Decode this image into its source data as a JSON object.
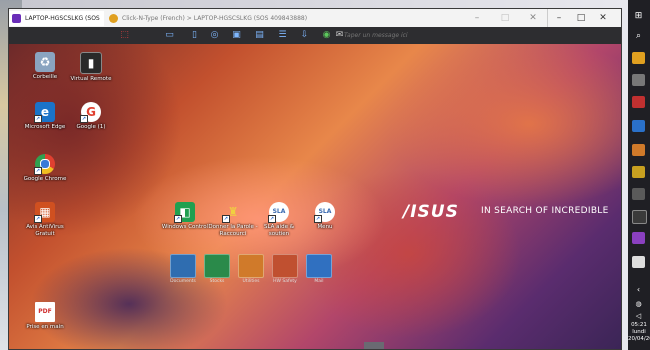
{
  "remote_window": {
    "tabs": [
      {
        "label": "LAPTOP-HGSCSLKG (SOS ",
        "color": "#6a2db8"
      },
      {
        "label": "Click-N-Type (French) > LAPTOP-HGSCSLKG (SOS 409843888)",
        "color": "#e0a020"
      }
    ],
    "controls": {
      "minimize": "–",
      "maximize": "□",
      "close": "✕"
    },
    "host_controls": {
      "minimize": "–",
      "maximize": "□",
      "close": "✕"
    }
  },
  "toolbar": {
    "message_placeholder": "Taper un message ici"
  },
  "desktop": {
    "icons": [
      {
        "label": "Corbeille",
        "icon": "recycle-bin-icon",
        "glyph": "♻",
        "color": "#8aa4c0"
      },
      {
        "label": "Virtual Remote",
        "icon": "virtual-remote-icon",
        "glyph": "▮",
        "color": "#2a2a2a"
      },
      {
        "label": "Microsoft Edge",
        "icon": "edge-icon",
        "glyph": "e",
        "color": "#1a73c8"
      },
      {
        "label": "Google (1)",
        "icon": "google-icon",
        "glyph": "G",
        "color": "#ffffff"
      },
      {
        "label": "Google Chrome",
        "icon": "chrome-icon",
        "glyph": "◉",
        "color": "#e0a020"
      },
      {
        "label": "Avis AntiVirus Gratuit",
        "icon": "antivirus-icon",
        "glyph": "▦",
        "color": "#d05020"
      },
      {
        "label": "Windows Control",
        "icon": "windows-control-icon",
        "glyph": "◧",
        "color": "#20a050"
      },
      {
        "label": "Donner la Parole - Raccourci",
        "icon": "donner-la-parole-icon",
        "glyph": "♜",
        "color": "#c03030"
      },
      {
        "label": "SLA aide & soutien",
        "icon": "sla-aide-icon",
        "glyph": "●",
        "color": "#3a6ab0"
      },
      {
        "label": "Menu",
        "icon": "menu-icon",
        "glyph": "●",
        "color": "#3a6ab0"
      },
      {
        "label": "Prise en main",
        "icon": "pdf-icon",
        "glyph": "PDF",
        "color": "#d03030"
      }
    ],
    "tiles": [
      {
        "label": "Documents",
        "color": "#2f6db0"
      },
      {
        "label": "Stocks",
        "color": "#2a8a4a"
      },
      {
        "label": "Utilities",
        "color": "#d07a2a"
      },
      {
        "label": "HW Safety",
        "color": "#c05030"
      },
      {
        "label": "Mail",
        "color": "#3070c0"
      }
    ],
    "brand": {
      "logo": "/ISUS",
      "tagline": "IN SEARCH OF INCREDIBLE"
    }
  },
  "host_taskbar": {
    "time": "05:21",
    "day": "lundi",
    "date": "20/04/20"
  }
}
